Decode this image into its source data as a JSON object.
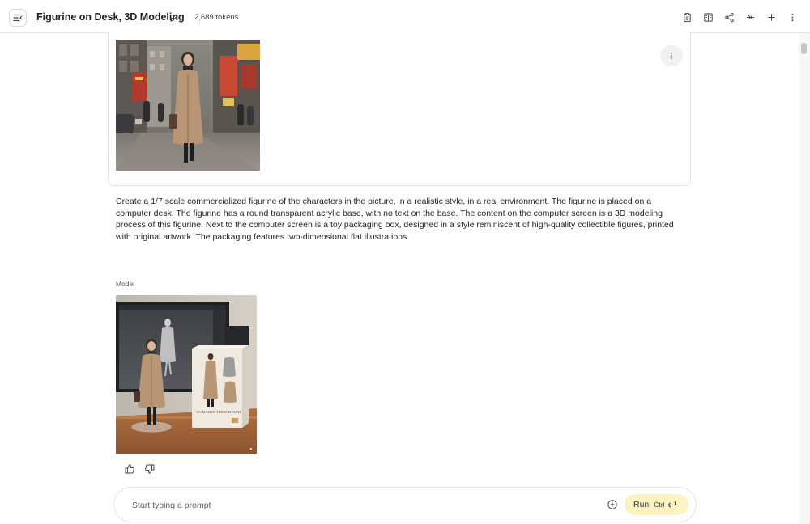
{
  "header": {
    "title": "Figurine on Desk, 3D Modeling",
    "tokens": "2,689 tokens",
    "icons": [
      "menu-collapse-icon",
      "edit-icon",
      "clipboard-icon",
      "compare-icon",
      "share-icon",
      "compress-icon",
      "add-icon",
      "more-vert-icon"
    ]
  },
  "conversation": {
    "user_prompt": "Create a 1/7 scale commercialized figurine of the characters in the picture, in a realistic style, in a real environment. The figurine is placed on a computer desk. The figurine has a round transparent acrylic base, with no text on the base. The content on the computer screen is a 3D modeling process of this figurine. Next to the computer screen is a toy packaging box, designed in a style reminiscent of high-quality collectible figures, printed with original artwork. The packaging features two-dimensional flat illustrations.",
    "model_label": "Model",
    "box_text": "WOMAN IN TRENCH COAT"
  },
  "input": {
    "placeholder": "Start typing a prompt",
    "run_label": "Run",
    "run_shortcut": "Ctrl"
  },
  "colors": {
    "run_button_bg": "#fdf2c2",
    "border": "#e3e3e3",
    "coat": "#b89574"
  }
}
